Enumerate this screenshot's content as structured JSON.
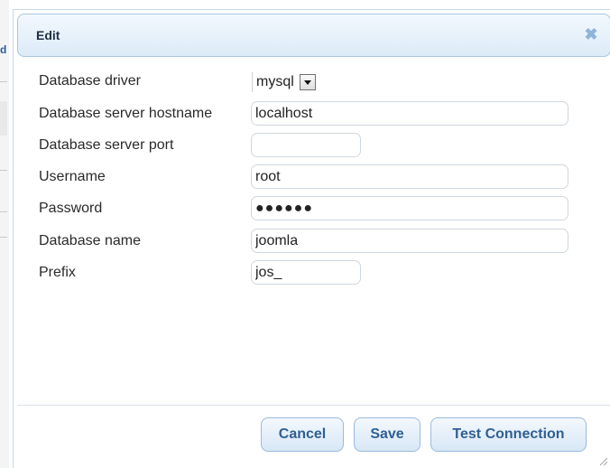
{
  "dialog": {
    "title": "Edit",
    "close_icon": "close-icon",
    "close_glyph": "✖"
  },
  "background": {
    "fragment": "d"
  },
  "form": {
    "driver": {
      "label": "Database driver",
      "value": "mysql"
    },
    "hostname": {
      "label": "Database server hostname",
      "value": "localhost"
    },
    "port": {
      "label": "Database server port",
      "value": ""
    },
    "username": {
      "label": "Username",
      "value": "root"
    },
    "password": {
      "label": "Password",
      "value": "●●●●●●"
    },
    "dbname": {
      "label": "Database name",
      "value": "joomla"
    },
    "prefix": {
      "label": "Prefix",
      "value": "jos_"
    }
  },
  "buttons": {
    "cancel": "Cancel",
    "save": "Save",
    "test": "Test Connection"
  },
  "colors": {
    "accent": "#2f5f93",
    "titlebar_border": "#a7c5e2"
  }
}
